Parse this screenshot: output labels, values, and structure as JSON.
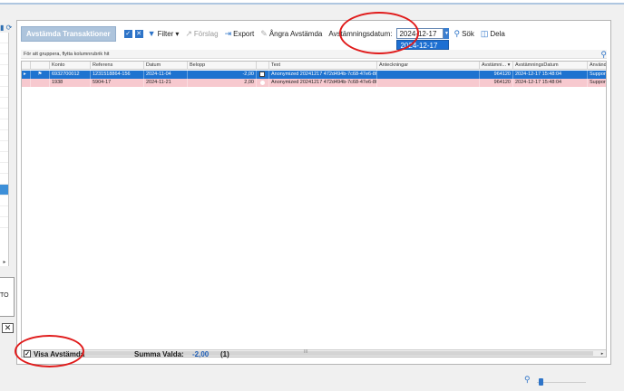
{
  "toolbar": {
    "title": "Avstämda Transaktioner",
    "filter_label": "Filter",
    "forslag_label": "Förslag",
    "export_label": "Export",
    "angra_label": "Ångra Avstämda",
    "datum_label": "Avstämningsdatum:",
    "datum_value": "2024-12-17",
    "datum_option": "2024-12-17",
    "sok_label": "Sök",
    "dela_label": "Dela"
  },
  "grid": {
    "group_hint": "För att gruppera, flytta kolumnrubrik hit",
    "columns": [
      "Konto",
      "Referens",
      "Datum",
      "Belopp",
      "Text",
      "Anteckningar",
      "Avstämni...",
      "AvstämningsDatum",
      "Använd"
    ],
    "rows": [
      {
        "konto": "6932700012",
        "referens": "1231518864-156",
        "datum": "2024-11-04",
        "belopp": "-2,00",
        "text": "Anonymized 20241217  472d494b-7c68-47e6-8fd",
        "anteckningar": "",
        "avst": "964120",
        "avstdatum": "2024-12-17 15:48:04",
        "anvand": "Suppor"
      },
      {
        "konto": "1938",
        "referens": "5904-17",
        "datum": "2024-11-21",
        "belopp": "2,00",
        "text": "Anonymized 20241217  472d494b-7c68-47e6-8fd",
        "anteckningar": "",
        "avst": "964120",
        "avstdatum": "2024-12-17 15:48:04",
        "anvand": "Suppor"
      }
    ],
    "scroll_mid": "III"
  },
  "footer": {
    "visa_label": "Visa Avstämda",
    "summa_label": "Summa Valda:",
    "summa_value": "-2,00",
    "summa_count": "(1)"
  },
  "left_panel": {
    "fragment_text": "TO"
  }
}
